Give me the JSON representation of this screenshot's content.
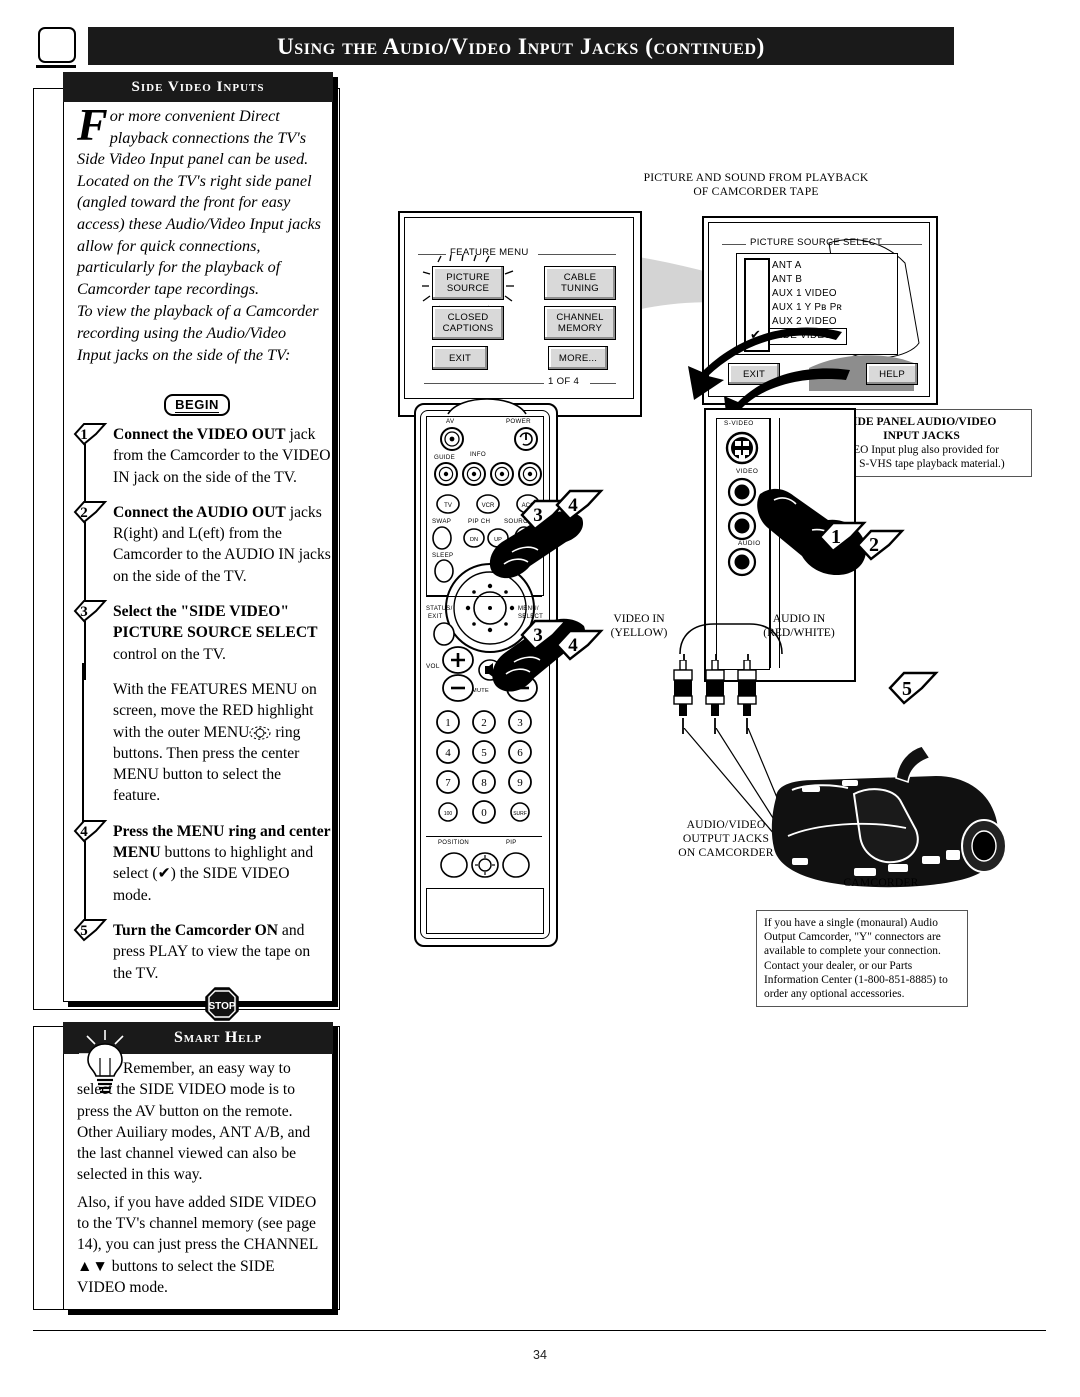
{
  "header": {
    "title": "Using the Audio/Video Input Jacks (continued)",
    "icon": "rounded-square-icon"
  },
  "side_video_panel": {
    "title": "Side Video Inputs",
    "intro_dropcap": "F",
    "intro_p1": "or more convenient Direct playback connections the TV's Side Video Input panel can be used. Located on the TV's right side panel (angled toward the front for easy access) these Audio/Video Input jacks allow for quick connections, particularly for the playback of Camcorder tape recordings.",
    "intro_p2": "To view the playback of a Camcorder recording using the Audio/Video Input jacks on the side of the TV:",
    "begin_label": "BEGIN",
    "stop_label": "STOP",
    "steps": [
      {
        "number": "1",
        "bold": "Connect the VIDEO OUT",
        "rest": " jack from the Camcorder to the VIDEO IN jack on the side of the TV."
      },
      {
        "number": "2",
        "bold": "Connect the AUDIO OUT",
        "rest": " jacks R(ight) and L(eft) from the Camcorder to the AUDIO IN jacks on the side of the TV."
      },
      {
        "number": "3",
        "bold": "Select the \"SIDE VIDEO\" PICTURE SOURCE SELECT",
        "rest": " control on the TV."
      },
      {
        "number": "4",
        "bold": "Press the MENU ring and center MENU",
        "rest": " buttons to highlight and select (✔) the SIDE VIDEO mode."
      },
      {
        "number": "5",
        "bold": "Turn the Camcorder ON",
        "rest": " and press PLAY to view the tape on the TV."
      }
    ],
    "step3_continuation_a": "With the FEATURES MENU on screen, move the RED highlight with the outer MENU",
    "step3_continuation_b": " ring buttons. Then press the center MENU button to select the feature."
  },
  "smart_help": {
    "title": "Smart Help",
    "icon": "lightbulb-icon",
    "p1": "Remember, an easy way to select the SIDE VIDEO mode is to press the AV button on the remote. Other Auiliary modes, ANT A/B, and the last channel viewed can also be selected in this way.",
    "p2": "Also, if you have added SIDE VIDEO to the TV's channel memory (see page 14), you can just press the CHANNEL ▲▼ buttons to select the SIDE VIDEO mode."
  },
  "illustration": {
    "playback_caption_line1": "PICTURE AND SOUND FROM PLAYBACK",
    "playback_caption_line2": "OF CAMCORDER TAPE",
    "feature_menu": {
      "title": "FEATURE MENU",
      "buttons": [
        "PICTURE SOURCE",
        "CABLE TUNING",
        "CLOSED CAPTIONS",
        "CHANNEL MEMORY",
        "EXIT",
        "MORE..."
      ],
      "page_indicator": "1  OF 4"
    },
    "picture_source_select": {
      "title": "PICTURE SOURCE SELECT",
      "items": [
        "ANT A",
        "ANT B",
        "AUX 1  VIDEO",
        "AUX 1  Y Pʙ Pʀ",
        "AUX 2  VIDEO",
        "SIDE VIDEO"
      ],
      "selected": "SIDE VIDEO",
      "check_mark": "✔",
      "exit_label": "EXIT",
      "help_label": "HELP"
    },
    "side_panel_note": {
      "title_line1": "SIDE PANEL AUDIO/VIDEO",
      "title_line2": "INPUT JACKS",
      "body": "(S-VIDEO Input plug also provided for possible S-VHS tape playback material.)"
    },
    "jack_labels": {
      "s_video": "S-VIDEO",
      "video": "VIDEO",
      "audio": "AUDIO",
      "video_in_line1": "VIDEO IN",
      "video_in_line2": "(YELLOW)",
      "audio_in_line1": "AUDIO IN",
      "audio_in_line2": "(RED/WHITE)"
    },
    "camcorder_labels": {
      "output_jacks_line1": "AUDIO/VIDEO",
      "output_jacks_line2": "OUTPUT JACKS",
      "output_jacks_line3": "ON CAMCORDER",
      "camcorder": "CAMCORDER"
    },
    "monaural_note": "If you have a single (monaural) Audio Output Camcorder, \"Y\" connectors are available to complete your connection. Contact your dealer, or our Parts Information Center (1-800-851-8885) to order any optional accessories.",
    "callouts": [
      "1",
      "2",
      "3",
      "4",
      "5"
    ],
    "remote_labels": {
      "av": "AV",
      "power": "POWER",
      "guide": "GUIDE",
      "info": "INFO",
      "tv": "TV",
      "vcr": "VCR",
      "acc": "ACC",
      "swap": "SWAP",
      "pip_ch": "PIP CH",
      "dn": "DN",
      "up": "UP",
      "source_front": "SOURCE FRONT",
      "sleep": "SLEEP",
      "status_exit_line1": "STATUS/",
      "status_exit_line2": "EXIT",
      "menu_select_line1": "MENU/",
      "menu_select_line2": "SELECT",
      "vol": "VOL",
      "mute": "MUTE",
      "position": "POSITION",
      "pip": "PIP",
      "keys": [
        "1",
        "2",
        "3",
        "4",
        "5",
        "6",
        "7",
        "8",
        "9",
        "0"
      ],
      "key_100": "100",
      "key_surf": "SURF"
    }
  },
  "page_number": "34"
}
